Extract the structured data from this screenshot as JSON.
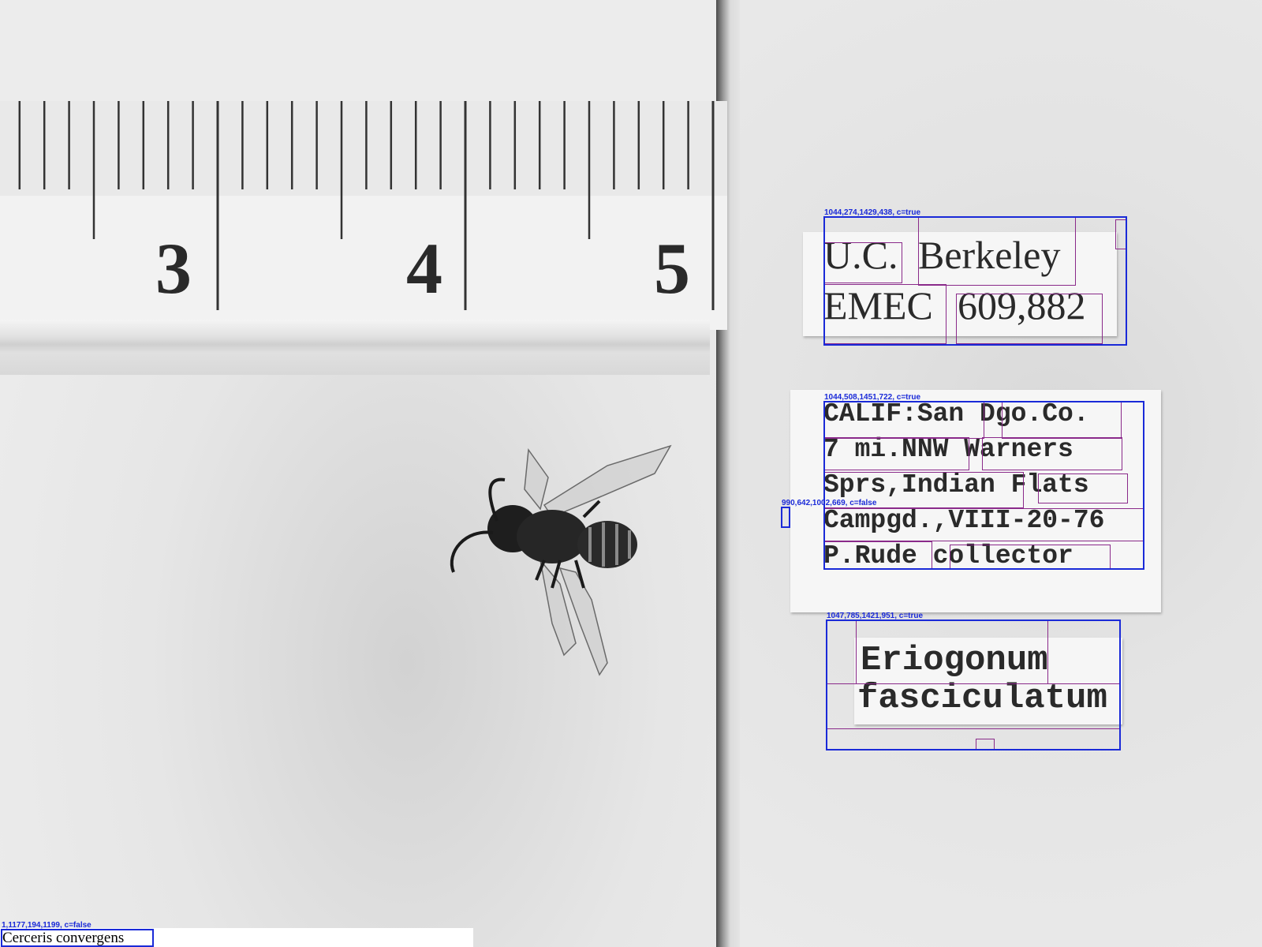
{
  "ruler": {
    "numbers": [
      "3",
      "4",
      "5"
    ]
  },
  "specimen": {
    "subject": "insect-specimen"
  },
  "labels": {
    "berkeley": {
      "line1_a": "U.C.",
      "line1_b": "Berkeley",
      "line2_a": "EMEC",
      "line2_b": "609,882"
    },
    "locality": {
      "line1": "CALIF:San Dgo.Co.",
      "line2": "7 mi.NNW Warners",
      "line3": "Sprs,Indian Flats",
      "line4": "Campgd.,VIII-20-76",
      "line5": "P.Rude collector"
    },
    "host": {
      "line1": "Eriogonum",
      "line2": "fasciculatum"
    }
  },
  "annotations": {
    "box1_tag": "1044,274,1429,438, c=true",
    "box2_tag": "1044,508,1451,722, c=true",
    "box3_tag": "990,642,1002,669, c=false",
    "box4_tag": "1047,785,1421,951, c=true",
    "box5_tag": "1,1177,194,1199, c=false"
  },
  "caption": {
    "text": "Cerceris convergens"
  },
  "colors": {
    "annotation_box": "#1a2ad8",
    "word_box": "#8a2a8a"
  }
}
